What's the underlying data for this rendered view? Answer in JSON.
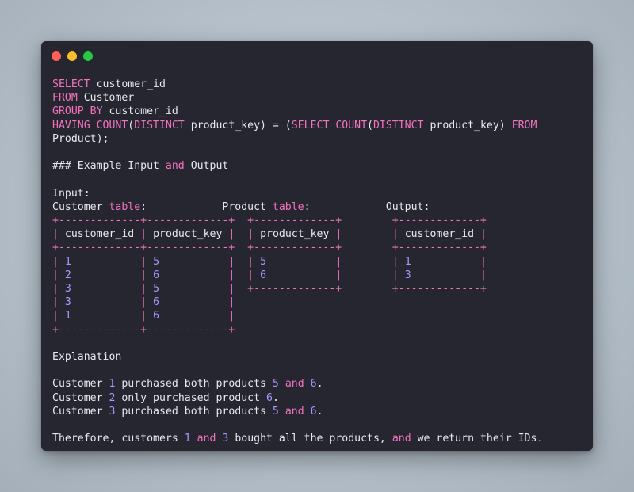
{
  "colors": {
    "window_bg": "#262630",
    "text": "#e8e8ee",
    "keyword": "#f472c0",
    "number": "#a996ff",
    "dot_close": "#ff5f57",
    "dot_minimize": "#febc2e",
    "dot_zoom": "#28c840"
  },
  "window_controls": [
    "close",
    "minimize",
    "zoom"
  ],
  "lines": [
    [
      {
        "t": "SELECT",
        "c": "kw"
      },
      {
        "t": " customer_id"
      }
    ],
    [
      {
        "t": "FROM",
        "c": "kw"
      },
      {
        "t": " Customer"
      }
    ],
    [
      {
        "t": "GROUP BY",
        "c": "kw"
      },
      {
        "t": " customer_id"
      }
    ],
    [
      {
        "t": "HAVING COUNT",
        "c": "kw"
      },
      {
        "t": "("
      },
      {
        "t": "DISTINCT",
        "c": "kw"
      },
      {
        "t": " product_key) = ("
      },
      {
        "t": "SELECT COUNT",
        "c": "kw"
      },
      {
        "t": "("
      },
      {
        "t": "DISTINCT",
        "c": "kw"
      },
      {
        "t": " product_key) "
      },
      {
        "t": "FROM",
        "c": "kw"
      }
    ],
    [
      {
        "t": "Product);"
      }
    ],
    [],
    [
      {
        "t": "### Example Input "
      },
      {
        "t": "and",
        "c": "kw"
      },
      {
        "t": " Output"
      }
    ],
    [],
    [
      {
        "t": "Input:"
      }
    ],
    [
      {
        "t": "Customer "
      },
      {
        "t": "table",
        "c": "kw"
      },
      {
        "t": ":            Product "
      },
      {
        "t": "table",
        "c": "kw"
      },
      {
        "t": ":            Output:"
      }
    ],
    [
      {
        "t": "+-------------+-------------+  +-------------+        +-------------+",
        "c": "tb"
      }
    ],
    [
      {
        "t": "|",
        "c": "tb"
      },
      {
        "t": " customer_id "
      },
      {
        "t": "|",
        "c": "tb"
      },
      {
        "t": " product_key "
      },
      {
        "t": "|",
        "c": "tb"
      },
      {
        "t": "  "
      },
      {
        "t": "|",
        "c": "tb"
      },
      {
        "t": " product_key "
      },
      {
        "t": "|",
        "c": "tb"
      },
      {
        "t": "        "
      },
      {
        "t": "|",
        "c": "tb"
      },
      {
        "t": " customer_id "
      },
      {
        "t": "|",
        "c": "tb"
      }
    ],
    [
      {
        "t": "+-------------+-------------+  +-------------+        +-------------+",
        "c": "tb"
      }
    ],
    [
      {
        "t": "| ",
        "c": "tb"
      },
      {
        "t": "1",
        "c": "num"
      },
      {
        "t": "           | ",
        "c": "tb"
      },
      {
        "t": "5",
        "c": "num"
      },
      {
        "t": "           |  | ",
        "c": "tb"
      },
      {
        "t": "5",
        "c": "num"
      },
      {
        "t": "           |        | ",
        "c": "tb"
      },
      {
        "t": "1",
        "c": "num"
      },
      {
        "t": "           |",
        "c": "tb"
      }
    ],
    [
      {
        "t": "| ",
        "c": "tb"
      },
      {
        "t": "2",
        "c": "num"
      },
      {
        "t": "           | ",
        "c": "tb"
      },
      {
        "t": "6",
        "c": "num"
      },
      {
        "t": "           |  | ",
        "c": "tb"
      },
      {
        "t": "6",
        "c": "num"
      },
      {
        "t": "           |        | ",
        "c": "tb"
      },
      {
        "t": "3",
        "c": "num"
      },
      {
        "t": "           |",
        "c": "tb"
      }
    ],
    [
      {
        "t": "| ",
        "c": "tb"
      },
      {
        "t": "3",
        "c": "num"
      },
      {
        "t": "           | ",
        "c": "tb"
      },
      {
        "t": "5",
        "c": "num"
      },
      {
        "t": "           |  +-------------+        +-------------+",
        "c": "tb"
      }
    ],
    [
      {
        "t": "| ",
        "c": "tb"
      },
      {
        "t": "3",
        "c": "num"
      },
      {
        "t": "           | ",
        "c": "tb"
      },
      {
        "t": "6",
        "c": "num"
      },
      {
        "t": "           |",
        "c": "tb"
      }
    ],
    [
      {
        "t": "| ",
        "c": "tb"
      },
      {
        "t": "1",
        "c": "num"
      },
      {
        "t": "           | ",
        "c": "tb"
      },
      {
        "t": "6",
        "c": "num"
      },
      {
        "t": "           |",
        "c": "tb"
      }
    ],
    [
      {
        "t": "+-------------+-------------+",
        "c": "tb"
      }
    ],
    [],
    [
      {
        "t": "Explanation"
      }
    ],
    [],
    [
      {
        "t": "Customer "
      },
      {
        "t": "1",
        "c": "num"
      },
      {
        "t": " purchased both products "
      },
      {
        "t": "5",
        "c": "num"
      },
      {
        "t": " "
      },
      {
        "t": "and",
        "c": "kw"
      },
      {
        "t": " "
      },
      {
        "t": "6",
        "c": "num"
      },
      {
        "t": "."
      }
    ],
    [
      {
        "t": "Customer "
      },
      {
        "t": "2",
        "c": "num"
      },
      {
        "t": " only purchased product "
      },
      {
        "t": "6",
        "c": "num"
      },
      {
        "t": "."
      }
    ],
    [
      {
        "t": "Customer "
      },
      {
        "t": "3",
        "c": "num"
      },
      {
        "t": " purchased both products "
      },
      {
        "t": "5",
        "c": "num"
      },
      {
        "t": " "
      },
      {
        "t": "and",
        "c": "kw"
      },
      {
        "t": " "
      },
      {
        "t": "6",
        "c": "num"
      },
      {
        "t": "."
      }
    ],
    [],
    [
      {
        "t": "Therefore, customers "
      },
      {
        "t": "1",
        "c": "num"
      },
      {
        "t": " "
      },
      {
        "t": "and",
        "c": "kw"
      },
      {
        "t": " "
      },
      {
        "t": "3",
        "c": "num"
      },
      {
        "t": " bought all the products, "
      },
      {
        "t": "and",
        "c": "kw"
      },
      {
        "t": " we return their IDs."
      }
    ]
  ]
}
